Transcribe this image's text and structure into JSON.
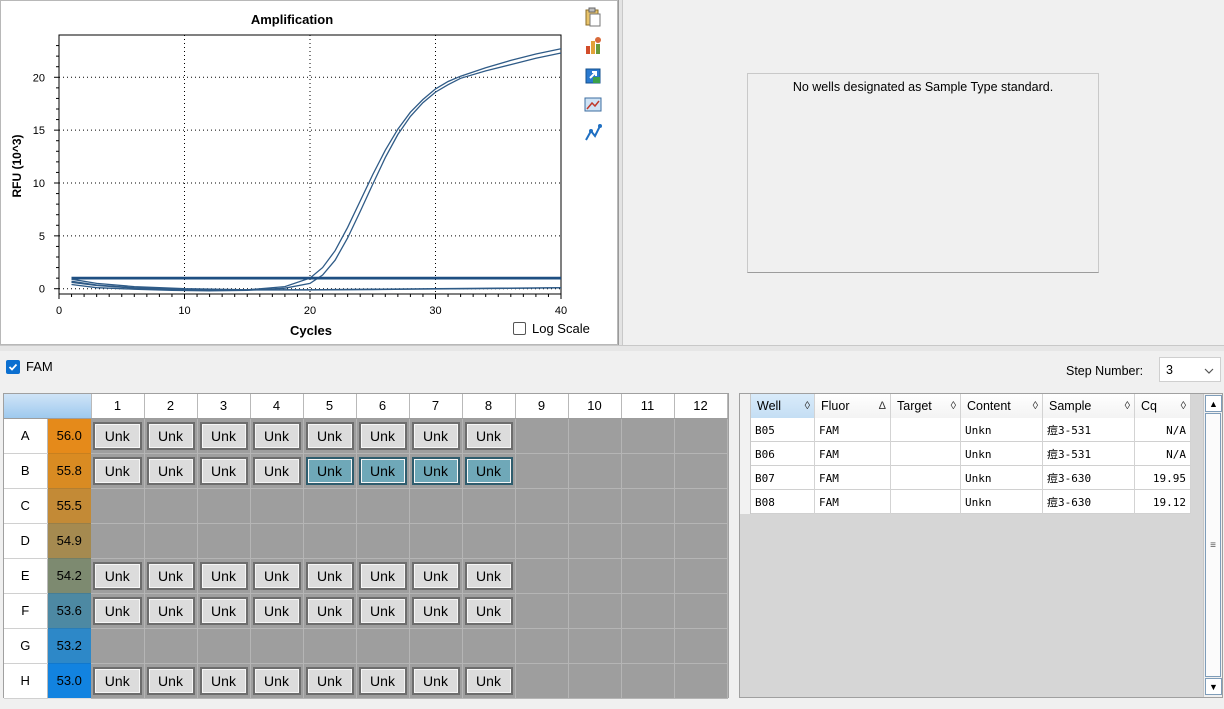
{
  "amplification": {
    "title": "Amplification",
    "log_scale_label": "Log Scale",
    "log_scale_checked": false
  },
  "chart_data": {
    "type": "line",
    "title": "Amplification",
    "xlabel": "Cycles",
    "ylabel": "RFU (10^3)",
    "xlim": [
      0,
      40
    ],
    "ylim": [
      -0.5,
      24
    ],
    "xticks": [
      0,
      10,
      20,
      30,
      40
    ],
    "yticks": [
      0,
      5,
      10,
      15,
      20
    ],
    "grid": true,
    "series": [
      {
        "x": [
          1,
          3,
          6,
          9,
          12,
          15,
          18,
          20,
          21,
          22,
          23,
          24,
          25,
          26,
          27,
          28,
          29,
          30,
          31,
          32,
          34,
          36,
          38,
          40
        ],
        "values": [
          0.6,
          0.3,
          0.05,
          -0.1,
          -0.15,
          -0.1,
          0.2,
          1.0,
          2.0,
          3.6,
          5.8,
          8.3,
          10.8,
          13.1,
          15.1,
          16.7,
          17.9,
          18.9,
          19.6,
          20.1,
          20.9,
          21.6,
          22.2,
          22.7
        ]
      },
      {
        "x": [
          1,
          3,
          6,
          9,
          12,
          15,
          18,
          20,
          21,
          22,
          23,
          24,
          25,
          26,
          27,
          28,
          29,
          30,
          31,
          32,
          34,
          36,
          38,
          40
        ],
        "values": [
          0.4,
          0.1,
          -0.05,
          -0.15,
          -0.2,
          -0.15,
          0.05,
          0.5,
          1.3,
          2.7,
          4.8,
          7.3,
          9.9,
          12.4,
          14.6,
          16.3,
          17.6,
          18.6,
          19.3,
          19.9,
          20.6,
          21.2,
          21.8,
          22.3
        ]
      },
      {
        "x": [
          1,
          40
        ],
        "values": [
          0.95,
          0.95
        ]
      },
      {
        "x": [
          1,
          40
        ],
        "values": [
          1.05,
          1.05
        ]
      },
      {
        "x": [
          1,
          3,
          6,
          10,
          15,
          20,
          25,
          30,
          35,
          40
        ],
        "values": [
          0.9,
          0.5,
          0.2,
          0.0,
          -0.1,
          -0.1,
          -0.05,
          0.0,
          0.05,
          0.1
        ]
      },
      {
        "x": [
          1,
          3,
          6,
          10,
          15,
          20,
          25,
          30,
          35,
          40
        ],
        "values": [
          0.7,
          0.35,
          0.1,
          -0.05,
          -0.12,
          -0.12,
          -0.08,
          -0.03,
          0.02,
          0.08
        ]
      }
    ]
  },
  "tools": [
    "copy-icon",
    "chart-style-icon",
    "export-icon",
    "image-icon",
    "line-style-icon"
  ],
  "standard_message": "No wells designated as Sample Type standard.",
  "fam": {
    "label": "FAM",
    "checked": true
  },
  "step": {
    "label": "Step Number:",
    "value": "3"
  },
  "plate": {
    "columns": [
      "1",
      "2",
      "3",
      "4",
      "5",
      "6",
      "7",
      "8",
      "9",
      "10",
      "11",
      "12"
    ],
    "rows": [
      {
        "label": "A",
        "temp": "56.0",
        "temp_color": "#e58a1a",
        "wells": [
          "Unk",
          "Unk",
          "Unk",
          "Unk",
          "Unk",
          "Unk",
          "Unk",
          "Unk"
        ],
        "selected": []
      },
      {
        "label": "B",
        "temp": "55.8",
        "temp_color": "#d98b22",
        "wells": [
          "Unk",
          "Unk",
          "Unk",
          "Unk",
          "Unk",
          "Unk",
          "Unk",
          "Unk"
        ],
        "selected": [
          4,
          5,
          6,
          7
        ]
      },
      {
        "label": "C",
        "temp": "55.5",
        "temp_color": "#c38a36",
        "wells": [],
        "selected": []
      },
      {
        "label": "D",
        "temp": "54.9",
        "temp_color": "#a58a50",
        "wells": [],
        "selected": []
      },
      {
        "label": "E",
        "temp": "54.2",
        "temp_color": "#7d8a70",
        "wells": [
          "Unk",
          "Unk",
          "Unk",
          "Unk",
          "Unk",
          "Unk",
          "Unk",
          "Unk"
        ],
        "selected": []
      },
      {
        "label": "F",
        "temp": "53.6",
        "temp_color": "#4d89a3",
        "wells": [
          "Unk",
          "Unk",
          "Unk",
          "Unk",
          "Unk",
          "Unk",
          "Unk",
          "Unk"
        ],
        "selected": []
      },
      {
        "label": "G",
        "temp": "53.2",
        "temp_color": "#2d88c8",
        "wells": [],
        "selected": []
      },
      {
        "label": "H",
        "temp": "53.0",
        "temp_color": "#1283e0",
        "wells": [
          "Unk",
          "Unk",
          "Unk",
          "Unk",
          "Unk",
          "Unk",
          "Unk",
          "Unk"
        ],
        "selected": []
      }
    ]
  },
  "data_table": {
    "headers": [
      {
        "label": "Well",
        "sort": "◊"
      },
      {
        "label": "Fluor",
        "sort": "Δ"
      },
      {
        "label": "Target",
        "sort": "◊"
      },
      {
        "label": "Content",
        "sort": "◊"
      },
      {
        "label": "Sample",
        "sort": "◊"
      },
      {
        "label": "Cq",
        "sort": "◊"
      }
    ],
    "rows": [
      [
        "B05",
        "FAM",
        "",
        "Unkn",
        "痘3-531",
        "N/A"
      ],
      [
        "B06",
        "FAM",
        "",
        "Unkn",
        "痘3-531",
        "N/A"
      ],
      [
        "B07",
        "FAM",
        "",
        "Unkn",
        "痘3-630",
        "19.95"
      ],
      [
        "B08",
        "FAM",
        "",
        "Unkn",
        "痘3-630",
        "19.12"
      ]
    ]
  },
  "colors": {
    "curve": "#2f5b87",
    "threshold": "#1f4f82",
    "grid": "#000000"
  }
}
